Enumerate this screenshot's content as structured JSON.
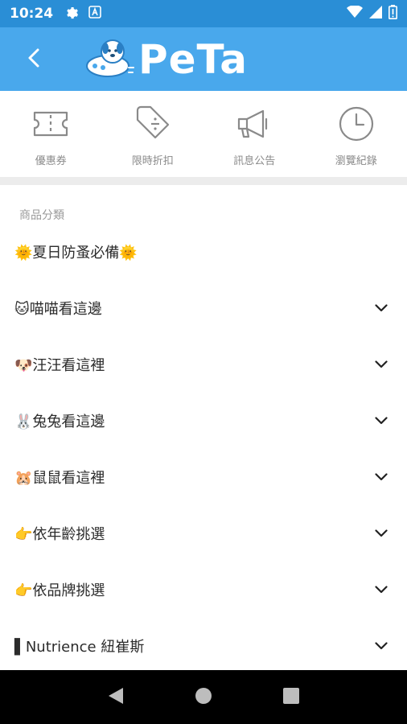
{
  "status_bar": {
    "time": "10:24",
    "icons": [
      "gear-icon",
      "a-badge-icon",
      "wifi-icon",
      "signal-icon",
      "battery-icon"
    ]
  },
  "app_bar": {
    "back_icon": "chevron-left-icon",
    "logo_text": "PeTa",
    "background": "#49a8ec"
  },
  "quick_actions": [
    {
      "label": "優惠券",
      "icon": "ticket-icon"
    },
    {
      "label": "限時折扣",
      "icon": "tag-icon"
    },
    {
      "label": "訊息公告",
      "icon": "megaphone-icon"
    },
    {
      "label": "瀏覽紀錄",
      "icon": "clock-icon"
    }
  ],
  "category_section": {
    "title": "商品分類",
    "items": [
      {
        "label": "🌞夏日防蚤必備🌞",
        "expandable": false
      },
      {
        "label": "🐱喵喵看這邊",
        "expandable": true
      },
      {
        "label": "🐶汪汪看這裡",
        "expandable": true
      },
      {
        "label": "🐰兔兔看這邊",
        "expandable": true
      },
      {
        "label": "🐹鼠鼠看這裡",
        "expandable": true
      },
      {
        "label": "👉依年齡挑選",
        "expandable": true
      },
      {
        "label": "👉依品牌挑選",
        "expandable": true
      },
      {
        "label": "▌Nutrience 紐崔斯",
        "expandable": true
      }
    ]
  },
  "nav_bar": {
    "buttons": [
      "back-triangle-icon",
      "home-circle-icon",
      "recents-square-icon"
    ]
  }
}
